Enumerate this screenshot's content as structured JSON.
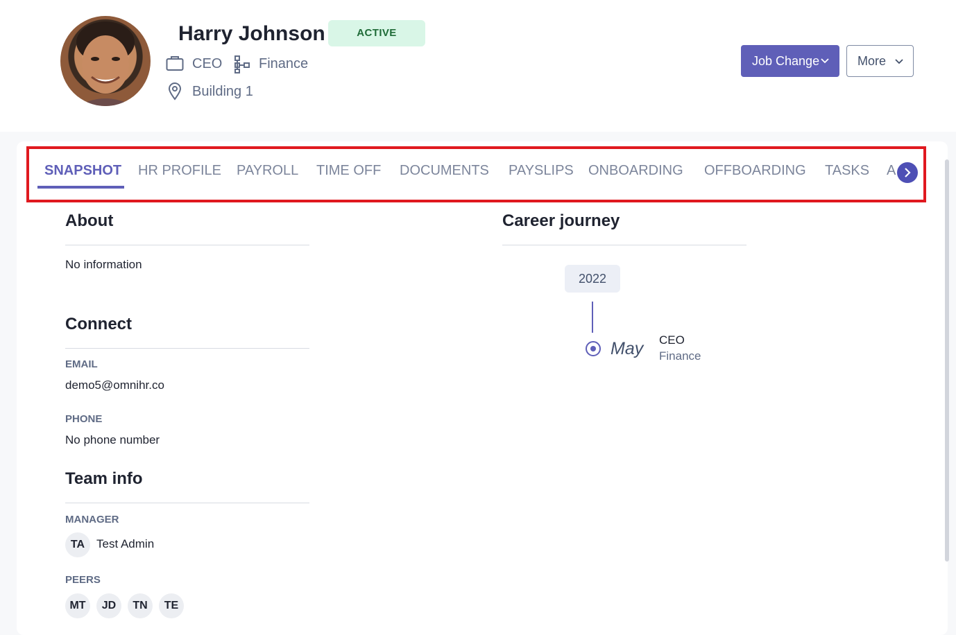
{
  "profile": {
    "name": "Harry Johnson",
    "status": "ACTIVE",
    "role": "CEO",
    "department": "Finance",
    "location": "Building 1",
    "avatar_icon": "employee-photo"
  },
  "actions": {
    "job_change_label": "Job Change",
    "more_label": "More"
  },
  "tabs": [
    {
      "label": "SNAPSHOT",
      "active": true
    },
    {
      "label": "HR PROFILE"
    },
    {
      "label": "PAYROLL"
    },
    {
      "label": "TIME OFF"
    },
    {
      "label": "DOCUMENTS"
    },
    {
      "label": "PAYSLIPS"
    },
    {
      "label": "ONBOARDING"
    },
    {
      "label": "OFFBOARDING"
    },
    {
      "label": "TASKS"
    },
    {
      "label": "A"
    }
  ],
  "about": {
    "title": "About",
    "text": "No information"
  },
  "connect": {
    "title": "Connect",
    "email_label": "EMAIL",
    "email": "demo5@omnihr.co",
    "phone_label": "PHONE",
    "phone": "No phone number"
  },
  "team": {
    "title": "Team info",
    "manager_label": "MANAGER",
    "manager_initials": "TA",
    "manager_name": "Test Admin",
    "peers_label": "PEERS",
    "peers": [
      "MT",
      "JD",
      "TN",
      "TE"
    ]
  },
  "career": {
    "title": "Career journey",
    "year": "2022",
    "month": "May",
    "role": "CEO",
    "department": "Finance"
  },
  "colors": {
    "accent": "#5f5fb8",
    "highlight": "#e0191f",
    "status_bg": "#d9f6e7",
    "status_text": "#1f6b38"
  }
}
